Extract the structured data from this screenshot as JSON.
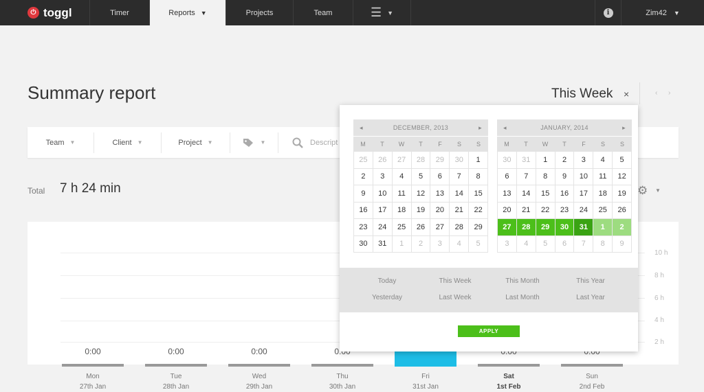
{
  "nav": {
    "logo_text": "toggl",
    "logo_icon": "power-icon",
    "timer": "Timer",
    "reports": "Reports",
    "projects": "Projects",
    "team": "Team",
    "menu_icon": "hamburger-icon",
    "info_icon": "info-icon",
    "user": "Zim42"
  },
  "page": {
    "title": "Summary report",
    "period": "This Week",
    "close_glyph": "×",
    "prev_glyph": "‹",
    "next_glyph": "›"
  },
  "filters": {
    "team": "Team",
    "client": "Client",
    "project": "Project",
    "tags_icon": "tag-icon",
    "search_icon": "search-icon",
    "description": "Descript"
  },
  "total": {
    "label": "Total",
    "value": "7 h 24 min"
  },
  "chart": {
    "y_labels": [
      "10 h",
      "8 h",
      "6 h",
      "4 h",
      "2 h"
    ],
    "days": [
      {
        "day": "Mon",
        "date": "27th Jan",
        "total": "0:00"
      },
      {
        "day": "Tue",
        "date": "28th Jan",
        "total": "0:00"
      },
      {
        "day": "Wed",
        "date": "29th Jan",
        "total": "0:00"
      },
      {
        "day": "Thu",
        "date": "30th Jan",
        "total": "0:00"
      },
      {
        "day": "Fri",
        "date": "31st Jan",
        "total": ""
      },
      {
        "day": "Sat",
        "date": "1st Feb",
        "total": "0:00"
      },
      {
        "day": "Sun",
        "date": "2nd Feb",
        "total": "0:00"
      }
    ],
    "accent_color": "#1dbde6"
  },
  "picker": {
    "dow": [
      "M",
      "T",
      "W",
      "T",
      "F",
      "S",
      "S"
    ],
    "prev_arrow": "◂",
    "next_arrow": "▸",
    "left_month": "DECEMBER, 2013",
    "right_month": "JANUARY, 2014",
    "left_weeks": [
      [
        "25",
        "26",
        "27",
        "28",
        "29",
        "30",
        "1"
      ],
      [
        "2",
        "3",
        "4",
        "5",
        "6",
        "7",
        "8"
      ],
      [
        "9",
        "10",
        "11",
        "12",
        "13",
        "14",
        "15"
      ],
      [
        "16",
        "17",
        "18",
        "19",
        "20",
        "21",
        "22"
      ],
      [
        "23",
        "24",
        "25",
        "26",
        "27",
        "28",
        "29"
      ],
      [
        "30",
        "31",
        "1",
        "2",
        "3",
        "4",
        "5"
      ]
    ],
    "right_weeks": [
      [
        "30",
        "31",
        "1",
        "2",
        "3",
        "4",
        "5"
      ],
      [
        "6",
        "7",
        "8",
        "9",
        "10",
        "11",
        "12"
      ],
      [
        "13",
        "14",
        "15",
        "16",
        "17",
        "18",
        "19"
      ],
      [
        "20",
        "21",
        "22",
        "23",
        "24",
        "25",
        "26"
      ],
      [
        "27",
        "28",
        "29",
        "30",
        "31",
        "1",
        "2"
      ],
      [
        "3",
        "4",
        "5",
        "6",
        "7",
        "8",
        "9"
      ]
    ],
    "presets": {
      "today": "Today",
      "yesterday": "Yesterday",
      "this_week": "This Week",
      "last_week": "Last Week",
      "this_month": "This Month",
      "last_month": "Last Month",
      "this_year": "This Year",
      "last_year": "Last Year"
    },
    "apply": "APPLY",
    "selection_color": "#4cbf1a"
  }
}
